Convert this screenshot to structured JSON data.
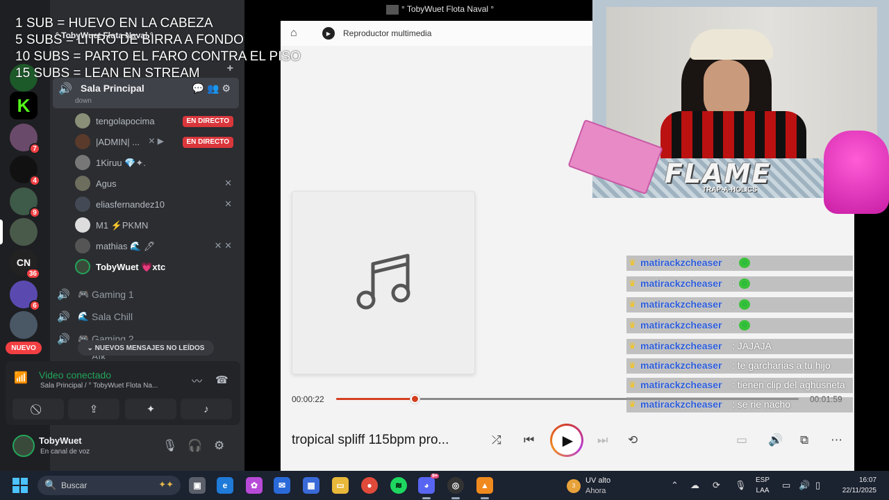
{
  "overlay_rules": [
    "1 SUB = HUEVO EN LA CABEZA",
    "5 SUBS = LITRO DE BIRRA A FONDO",
    "10 SUBS = PARTO EL FARO CONTRA EL PISO",
    "15 SUBS = LEAN EN STREAM"
  ],
  "window_title": "° TobyWuet Flota Naval °",
  "discord": {
    "server_name": "° TobyWuet Flota Naval °",
    "server_badges": [
      "7",
      "4",
      "9",
      "36",
      "6"
    ],
    "server_cn_label": "CN",
    "kick_label": "K",
    "nuevo_label": "NUEVO",
    "active_voice": {
      "name": "Sala Principal",
      "status": "down"
    },
    "members": [
      {
        "name": "tengolapocima",
        "live": "EN DIRECTO"
      },
      {
        "name": "|ADMIN| ...",
        "live": "EN DIRECTO"
      },
      {
        "name": "1Kiruu 💎✦."
      },
      {
        "name": "Agus"
      },
      {
        "name": "eliasfernandez10"
      },
      {
        "name": "M1 ⚡PKMN"
      },
      {
        "name": "mathias 🌊 🖊"
      },
      {
        "name": "TobyWuet 💗xtc"
      }
    ],
    "channels": [
      {
        "name": "Gaming 1"
      },
      {
        "name": "Sala Chill"
      },
      {
        "name": "Gaming 2"
      },
      {
        "name": "Afk"
      }
    ],
    "new_messages": "NUEVOS MENSAJES NO LEÍDOS",
    "voice_connection": {
      "title": "Video conectado",
      "location": "Sala Principal / ° TobyWuet Flota Na..."
    },
    "user": {
      "name": "TobyWuet",
      "status": "En canal de voz"
    }
  },
  "player": {
    "app_name": "Reproductor multimedia",
    "current_time": "00:00:22",
    "total_time": "00:01:59",
    "progress_fraction": 0.17,
    "track_title": "tropical spliff 115bpm pro..."
  },
  "chat": [
    {
      "user": "matirackzcheaser",
      "message": ":"
    },
    {
      "user": "matirackzcheaser",
      "message": ":"
    },
    {
      "user": "matirackzcheaser",
      "message": ":"
    },
    {
      "user": "matirackzcheaser",
      "message": ":"
    },
    {
      "user": "matirackzcheaser",
      "message": ": JAJAJA"
    },
    {
      "user": "matirackzcheaser",
      "message": ": te garcharias a tu hijo"
    },
    {
      "user": "matirackzcheaser",
      "message": ": tienen clip del aghusneta"
    },
    {
      "user": "matirackzcheaser",
      "message": ": se rie nacho"
    }
  ],
  "webcam": {
    "banner_title": "FLAME",
    "banner_subtitle": "TRAP-A-HOLICS"
  },
  "taskbar": {
    "search_placeholder": "Buscar",
    "weather_title": "UV alto",
    "weather_sub": "Ahora",
    "weather_badge": "3",
    "discord_badge": "9+",
    "lang_1": "ESP",
    "lang_2": "LAA",
    "time": "16:07",
    "date": "22/11/2025"
  },
  "colors": {
    "discord_bg": "#2b2d31",
    "live_red": "#da373c",
    "connected_green": "#23a55a",
    "seek_accent": "#d33f1e",
    "chat_user_blue": "#2b5bd8"
  }
}
